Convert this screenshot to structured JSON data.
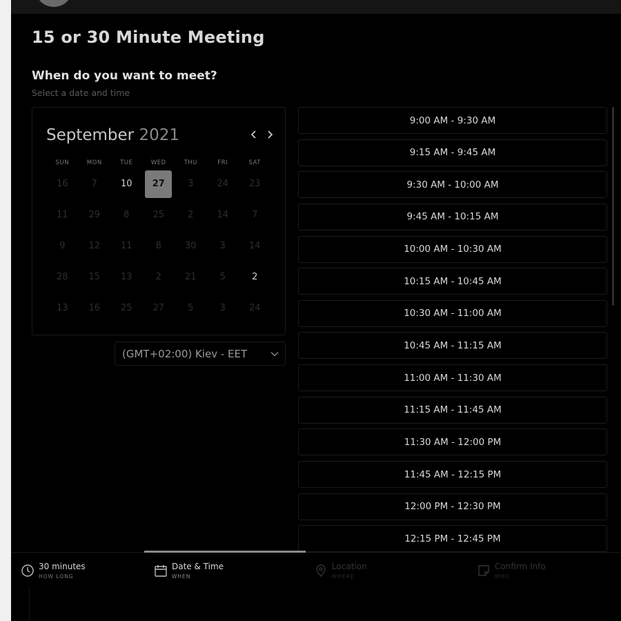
{
  "page": {
    "title": "15 or 30 Minute Meeting",
    "subtitle": "When do you want to meet?",
    "hint": "Select a date and time"
  },
  "calendar": {
    "month": "September",
    "year": "2021",
    "prev_icon": "chevron-left-icon",
    "next_icon": "chevron-right-icon",
    "weekdays": [
      "SUN",
      "MON",
      "TUE",
      "WED",
      "THU",
      "FRI",
      "SAT"
    ],
    "weeks": [
      [
        {
          "day": "16",
          "state": "disabled"
        },
        {
          "day": "7",
          "state": "disabled"
        },
        {
          "day": "10",
          "state": "available"
        },
        {
          "day": "27",
          "state": "selected"
        },
        {
          "day": "3",
          "state": "disabled"
        },
        {
          "day": "24",
          "state": "disabled"
        },
        {
          "day": "23",
          "state": "disabled"
        }
      ],
      [
        {
          "day": "11",
          "state": "disabled"
        },
        {
          "day": "29",
          "state": "disabled"
        },
        {
          "day": "8",
          "state": "disabled"
        },
        {
          "day": "25",
          "state": "disabled"
        },
        {
          "day": "2",
          "state": "disabled"
        },
        {
          "day": "14",
          "state": "disabled"
        },
        {
          "day": "7",
          "state": "disabled"
        }
      ],
      [
        {
          "day": "9",
          "state": "disabled"
        },
        {
          "day": "12",
          "state": "disabled"
        },
        {
          "day": "11",
          "state": "disabled"
        },
        {
          "day": "8",
          "state": "disabled"
        },
        {
          "day": "30",
          "state": "disabled"
        },
        {
          "day": "3",
          "state": "disabled"
        },
        {
          "day": "14",
          "state": "disabled"
        }
      ],
      [
        {
          "day": "28",
          "state": "disabled"
        },
        {
          "day": "15",
          "state": "disabled"
        },
        {
          "day": "13",
          "state": "disabled"
        },
        {
          "day": "2",
          "state": "disabled"
        },
        {
          "day": "21",
          "state": "disabled"
        },
        {
          "day": "5",
          "state": "disabled"
        },
        {
          "day": "2",
          "state": "available"
        }
      ],
      [
        {
          "day": "13",
          "state": "disabled"
        },
        {
          "day": "16",
          "state": "disabled"
        },
        {
          "day": "25",
          "state": "disabled"
        },
        {
          "day": "27",
          "state": "disabled"
        },
        {
          "day": "5",
          "state": "disabled"
        },
        {
          "day": "3",
          "state": "disabled"
        },
        {
          "day": "24",
          "state": "disabled"
        }
      ]
    ]
  },
  "timezone": {
    "value": "(GMT+02:00) Kiev - EET",
    "icon": "chevron-down-icon"
  },
  "time_slots": [
    "9:00 AM - 9:30 AM",
    "9:15 AM - 9:45 AM",
    "9:30 AM - 10:00 AM",
    "9:45 AM - 10:15 AM",
    "10:00 AM - 10:30 AM",
    "10:15 AM - 10:45 AM",
    "10:30 AM - 11:00 AM",
    "10:45 AM - 11:15 AM",
    "11:00 AM - 11:30 AM",
    "11:15 AM - 11:45 AM",
    "11:30 AM - 12:00 PM",
    "11:45 AM - 12:15 PM",
    "12:00 PM - 12:30 PM",
    "12:15 PM - 12:45 PM"
  ],
  "tabs": [
    {
      "label": "30 minutes",
      "sub": "HOW LONG",
      "icon": "clock-icon",
      "state": "done"
    },
    {
      "label": "Date & Time",
      "sub": "WHEN",
      "icon": "calendar-icon",
      "state": "active"
    },
    {
      "label": "Location",
      "sub": "WHERE",
      "icon": "location-pin-icon",
      "state": "future"
    },
    {
      "label": "Confirm Info",
      "sub": "WHO",
      "icon": "note-icon",
      "state": "future"
    }
  ],
  "colors": {
    "background": "#000000",
    "selected_day": "#7a7a7a",
    "border": "#1b1b1b",
    "text": "#d8d8d8"
  }
}
